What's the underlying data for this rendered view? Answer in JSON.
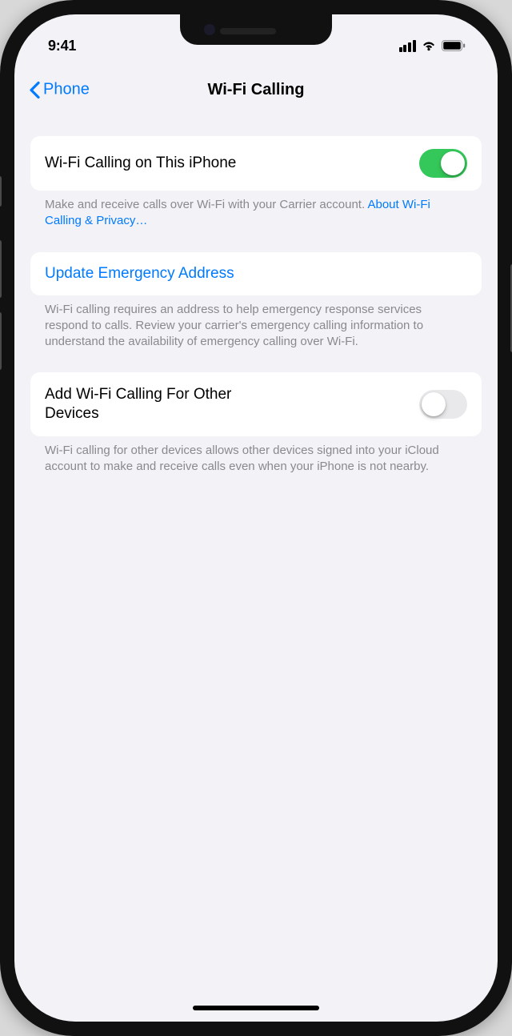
{
  "status": {
    "time": "9:41"
  },
  "nav": {
    "back_label": "Phone",
    "title": "Wi-Fi Calling"
  },
  "group1": {
    "row_label": "Wi-Fi Calling on This iPhone",
    "toggle_on": true,
    "footer_text": "Make and receive calls over Wi-Fi with your Carrier account. ",
    "footer_link": "About Wi-Fi Calling & Privacy…"
  },
  "group2": {
    "link_label": "Update Emergency Address",
    "footer_text": "Wi-Fi calling requires an address to help emergency response services respond to calls. Review your carrier's emergency calling information to understand the availability of emergency calling over Wi-Fi."
  },
  "group3": {
    "row_label": "Add Wi-Fi Calling For Other Devices",
    "toggle_on": false,
    "footer_text": "Wi-Fi calling for other devices allows other devices signed into your iCloud account to make and receive calls even when your iPhone is not nearby."
  }
}
